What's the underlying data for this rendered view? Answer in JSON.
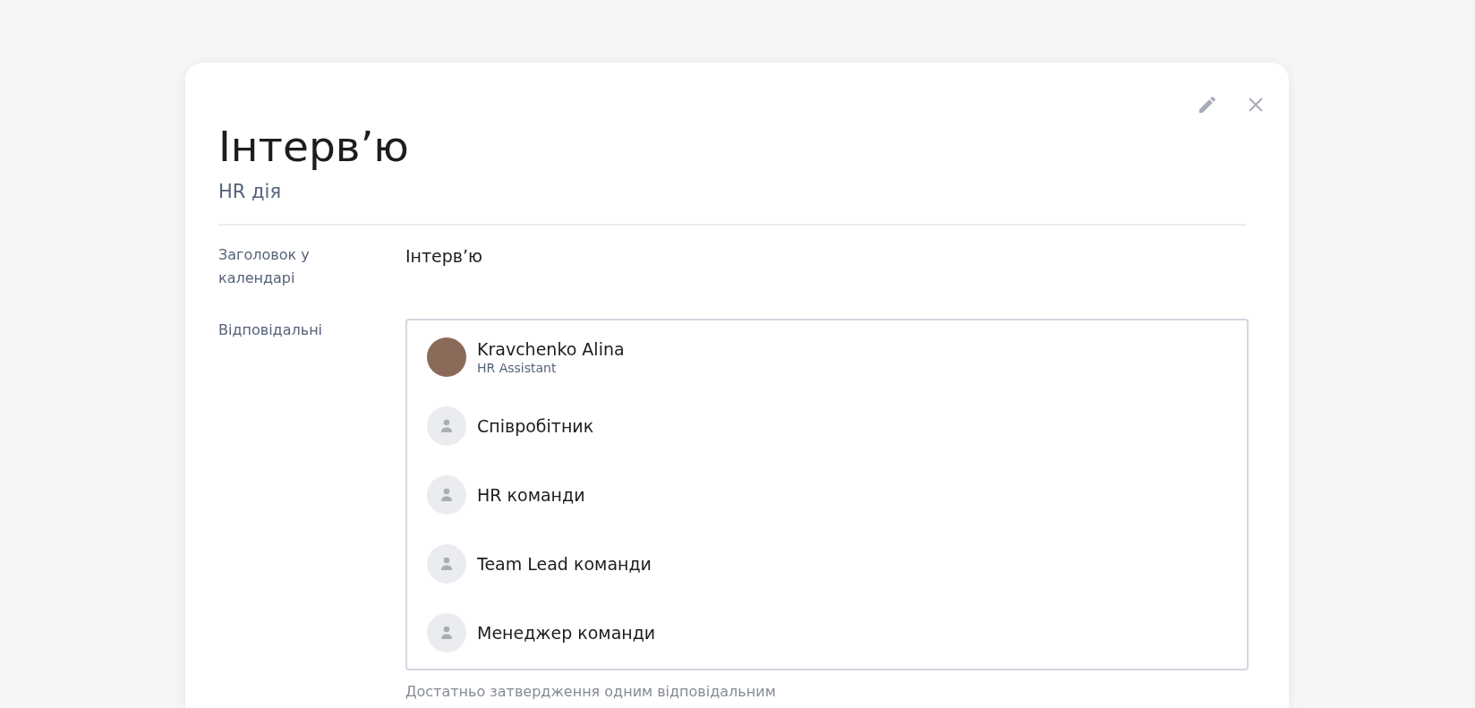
{
  "dialog": {
    "title": "Інтерв’ю",
    "subtitle": "HR дія"
  },
  "fields": [
    {
      "label": "Заголовок у календарі",
      "value": "Інтерв’ю"
    }
  ],
  "responsible": {
    "label": "Відповідальні",
    "assignees": [
      {
        "kind": "photo",
        "name": "Kravchenko Alina",
        "role": "HR Assistant"
      },
      {
        "kind": "placeholder",
        "name": "Співробітник"
      },
      {
        "kind": "placeholder",
        "name": "HR команди"
      },
      {
        "kind": "placeholder",
        "name": "Team Lead команди"
      },
      {
        "kind": "placeholder",
        "name": "Менеджер команди"
      }
    ],
    "hint": "Достатньо затвердження одним відповідальним"
  }
}
